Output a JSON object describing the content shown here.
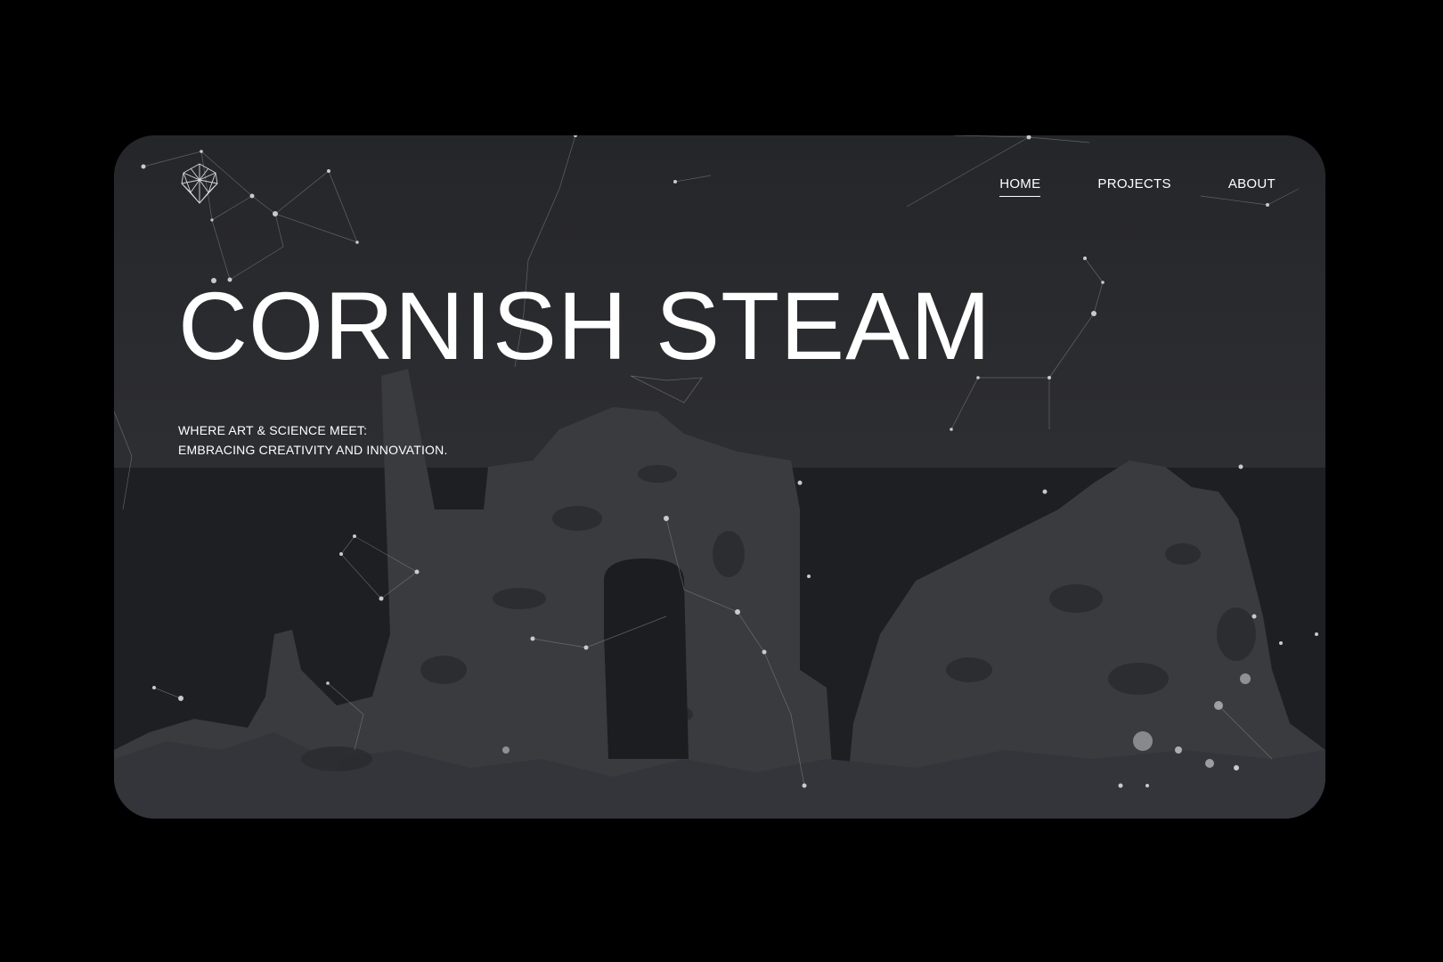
{
  "nav": {
    "items": [
      {
        "label": "HOME",
        "active": true
      },
      {
        "label": "PROJECTS",
        "active": false
      },
      {
        "label": "ABOUT",
        "active": false
      }
    ]
  },
  "hero": {
    "title": "CORNISH STEAM",
    "tagline_line1": "WHERE ART & SCIENCE MEET:",
    "tagline_line2": "EMBRACING CREATIVITY AND INNOVATION."
  },
  "icons": {
    "logo": "geodesic-diamond-logo-icon"
  },
  "colors": {
    "page_background": "#000000",
    "sky": "#2a2b2e",
    "ground": "#1e1f22",
    "ruin": "#3b3c40",
    "text": "#ffffff"
  }
}
